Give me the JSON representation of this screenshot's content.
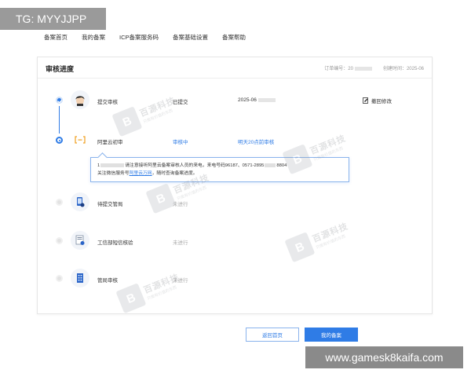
{
  "overlays": {
    "top_left": "TG: MYYJJPP",
    "bottom_right": "www.gamesk8kaifa.com"
  },
  "topnav": [
    "备案首页",
    "我的备案",
    "ICP备案服务码",
    "备案基础设置",
    "备案帮助"
  ],
  "card": {
    "title": "审核进度",
    "order_label": "订单编号：20",
    "created_label": "创建时间：2025-06"
  },
  "steps": [
    {
      "label": "提交审核",
      "status": "已提交",
      "info": "2025-06",
      "action": "撤回修改",
      "state": "done",
      "icon": "avatar-icon"
    },
    {
      "label": "阿里云初审",
      "status": "审核中",
      "info": "明天20点前审核",
      "state": "current",
      "icon": "shield-icon"
    },
    {
      "label": "待提交管局",
      "status": "未进行",
      "state": "todo",
      "icon": "phone-icon"
    },
    {
      "label": "工信部短信核验",
      "status": "未进行",
      "state": "todo",
      "icon": "document-icon"
    },
    {
      "label": "管局审核",
      "status": "未进行",
      "state": "todo",
      "icon": "building-icon"
    }
  ],
  "tip": {
    "line1_prefix": "1",
    "line1_text": "请注意接听阿里云备案审核人员的来电，来电号码96187、0571-2895",
    "line1_suffix": "8804",
    "line2_prefix": "关注微信服务号",
    "line2_link": "阿里云万网",
    "line2_suffix": "，随时查询备案进度。"
  },
  "buttons": {
    "back": "返回首页",
    "my": "我的备案"
  },
  "watermark": {
    "logo": "B",
    "name": "百源科技",
    "tagline": "只做有价值的东西"
  },
  "colors": {
    "accent": "#2f7ce6",
    "border": "#8ab3ec",
    "muted": "#aaaaaa"
  }
}
